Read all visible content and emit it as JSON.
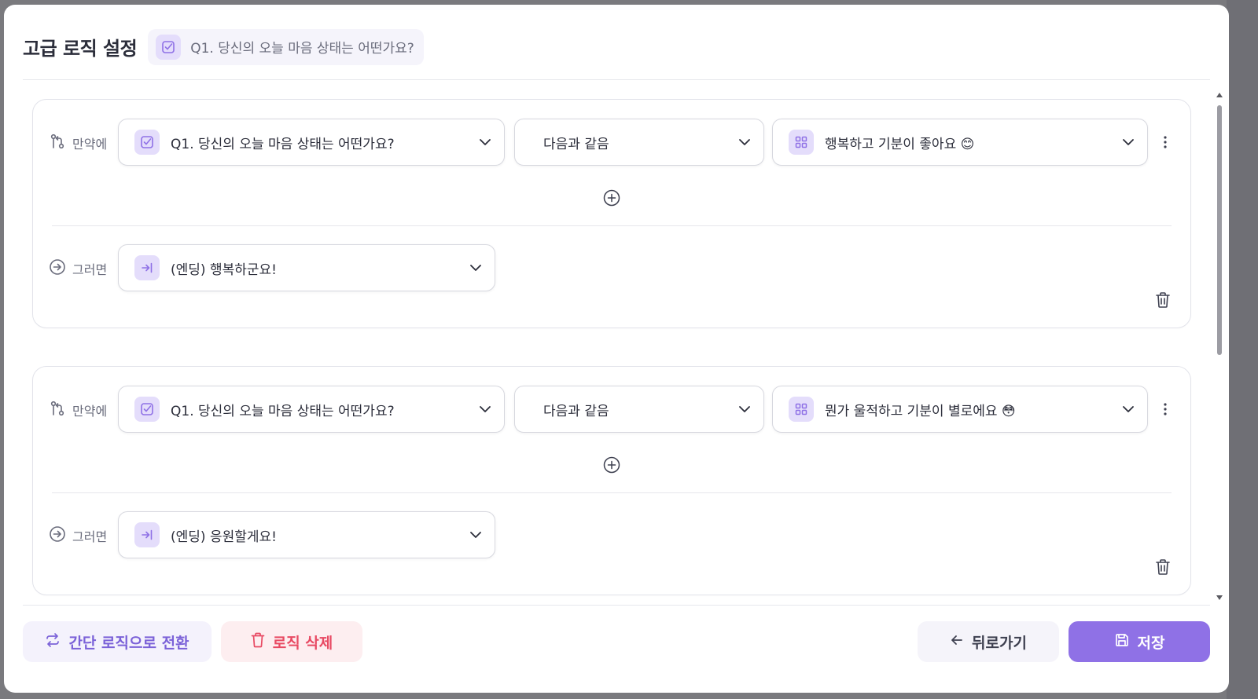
{
  "header": {
    "title": "고급 로직 설정",
    "question_chip": "Q1. 당신의 오늘 마음 상태는 어떤가요?"
  },
  "rules": [
    {
      "if_label": "만약에",
      "question": "Q1. 당신의 오늘 마음 상태는 어떤가요?",
      "operator": "다음과 같음",
      "answer": "행복하고 기분이 좋아요 😊",
      "then_label": "그러면",
      "action": "(엔딩) 행복하군요!"
    },
    {
      "if_label": "만약에",
      "question": "Q1. 당신의 오늘 마음 상태는 어떤가요?",
      "operator": "다음과 같음",
      "answer": "뭔가 울적하고 기분이 별로에요 😳",
      "then_label": "그러면",
      "action": "(엔딩) 응원할게요!"
    }
  ],
  "footer": {
    "switch_label": "간단 로직으로 전환",
    "delete_label": "로직 삭제",
    "back_label": "뒤로가기",
    "save_label": "저장"
  },
  "icons": {
    "checkbox": "checkbox-icon",
    "grid": "grid-icon",
    "arrow_in": "arrow-into-icon",
    "branch": "branch-icon",
    "circle_arrow": "circle-arrow-right-icon"
  },
  "colors": {
    "accent": "#8f71e6",
    "accent_light": "#e4ddfb",
    "danger": "#e84a63"
  }
}
